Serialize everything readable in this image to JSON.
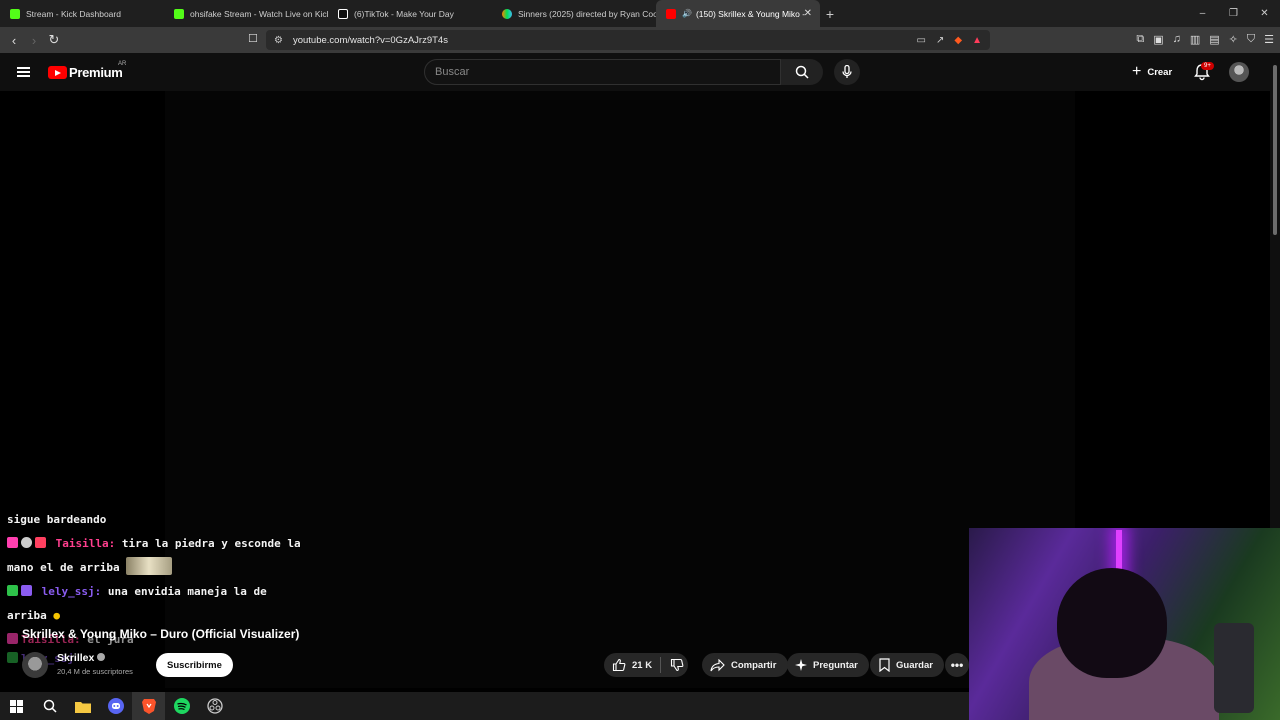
{
  "browser": {
    "tabs": [
      {
        "label": "Stream - Kick Dashboard",
        "favicon_color": "#53fc18",
        "icon": "kick-icon"
      },
      {
        "label": "ohsifake Stream - Watch Live on Kick",
        "favicon_color": "#53fc18",
        "icon": "kick-icon"
      },
      {
        "label": "(6)TikTok - Make Your Day",
        "favicon_color": "#ffffff",
        "icon": "tiktok-icon"
      },
      {
        "label": "Sinners (2025) directed by Ryan Coo",
        "favicon_color": "#40bcf4",
        "icon": "letterboxd-icon"
      },
      {
        "label": "(150) Skrillex & Young Miko -",
        "favicon_color": "#ff0000",
        "icon": "youtube-icon",
        "active": true
      }
    ],
    "new_tab": "+",
    "window_controls": [
      "–",
      "❐",
      "✕"
    ],
    "url": "youtube.com/watch?v=0GzAJrz9T4s"
  },
  "youtube": {
    "logo_text": "Premium",
    "country_code": "AR",
    "search_placeholder": "Buscar",
    "create_label": "Crear",
    "notifications_badge": "9+"
  },
  "chat": {
    "lines": [
      {
        "text": "sigue bardeando"
      },
      {
        "user": "Taisilla:",
        "text": " tira la piedra y esconde la",
        "color": "#ff3f8e"
      },
      {
        "text": "mano el de arriba"
      },
      {
        "user": "lely_ssj:",
        "text": " una envidia maneja la de",
        "color": "#8a5cf0"
      },
      {
        "text": "arriba"
      },
      {
        "user": "Taisilla:",
        "text": " el jura",
        "color": "#ff3f8e"
      },
      {
        "user": "lely_ssj",
        "text": "",
        "color": "#8a5cf0"
      }
    ]
  },
  "video": {
    "title": "Skrillex & Young Miko – Duro (Official Visualizer)",
    "channel": "Skrillex",
    "subscribers": "20,4 M de suscriptores",
    "subscribe_label": "Suscribirme",
    "likes": "21 K",
    "share_label": "Compartir",
    "ask_label": "Preguntar",
    "save_label": "Guardar",
    "more_label": "•••"
  },
  "taskbar": {
    "items": [
      "windows-start-icon",
      "search-icon",
      "file-explorer-icon",
      "discord-icon",
      "brave-icon",
      "spotify-icon",
      "obs-icon"
    ]
  }
}
